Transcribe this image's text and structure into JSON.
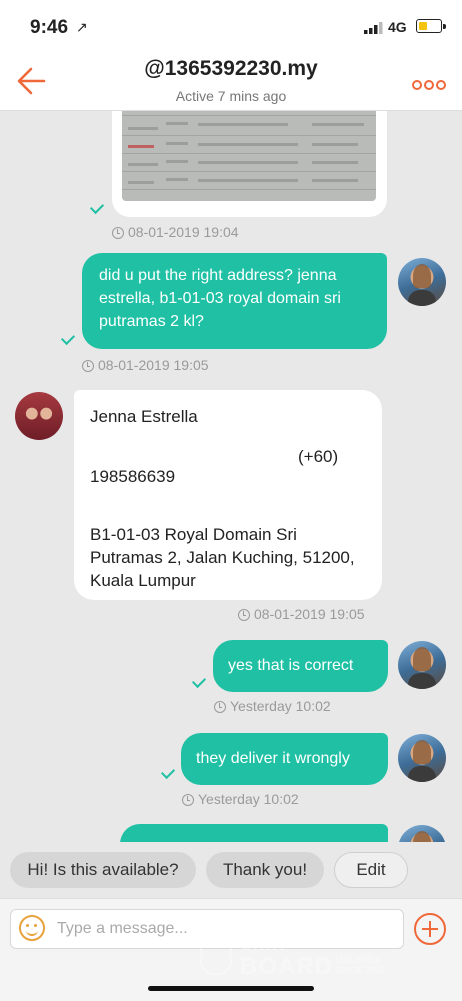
{
  "status_bar": {
    "time": "9:46",
    "location_glyph": "↗",
    "network": "4G",
    "battery_color": "#f2c40e"
  },
  "header": {
    "title": "@1365392230.my",
    "subtitle": "Active 7 mins ago",
    "accent_color": "#f0683a"
  },
  "messages": [
    {
      "type": "image",
      "side": "out",
      "timestamp": "08-01-2019 19:04"
    },
    {
      "type": "text",
      "side": "out",
      "text": "did u put the right address? jenna estrella, b1-01-03 royal domain sri putramas 2 kl?",
      "timestamp": "08-01-2019 19:05"
    },
    {
      "type": "address",
      "side": "in",
      "name": "Jenna Estrella",
      "phone_code": "(+60)",
      "phone": "198586639",
      "address": "B1-01-03 Royal Domain Sri Putramas 2, Jalan Kuching, 51200, Kuala Lumpur",
      "timestamp": "08-01-2019 19:05"
    },
    {
      "type": "text",
      "side": "out",
      "text": "yes that is correct",
      "timestamp": "Yesterday 10:02"
    },
    {
      "type": "text",
      "side": "out",
      "text": "they deliver it wrongly",
      "timestamp": "Yesterday 10:02"
    }
  ],
  "quick_replies": [
    "Hi! Is this available?",
    "Thank you!",
    "Edit"
  ],
  "composer": {
    "placeholder": "Type a message..."
  },
  "watermark": {
    "line1": "CHAT",
    "line2": "BOARD",
    "line3": "MALAYSIA",
    "line4": "SINCE 2019"
  },
  "colors": {
    "outgoing_bubble": "#1fc0a4",
    "incoming_bubble": "#ffffff",
    "background": "#e8e8e8"
  },
  "icons": [
    "location-arrow-icon",
    "signal-icon",
    "battery-icon",
    "back-arrow-icon",
    "more-dots-icon",
    "check-icon",
    "clock-icon",
    "smiley-icon",
    "plus-circle-icon"
  ]
}
